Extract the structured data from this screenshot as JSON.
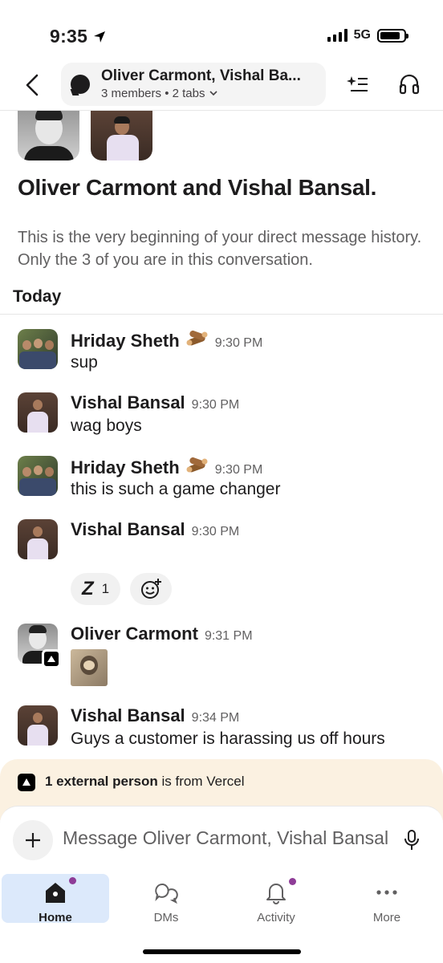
{
  "status_bar": {
    "time": "9:35",
    "network": "5G"
  },
  "header": {
    "title": "Oliver Carmont, Vishal Ba...",
    "subtitle": "3 members • 2 tabs"
  },
  "intro": {
    "title": "Oliver Carmont and Vishal Bansal.",
    "description": "This is the very beginning of your direct message history. Only the 3 of you are in this conversation."
  },
  "day_label": "Today",
  "messages": [
    {
      "name": "Hriday Sheth",
      "time": "9:30 PM",
      "text": "sup",
      "status_emoji": "wood-logs-icon"
    },
    {
      "name": "Vishal Bansal",
      "time": "9:30 PM",
      "text": "wag boys"
    },
    {
      "name": "Hriday Sheth",
      "time": "9:30 PM",
      "text": "this is such a game changer",
      "status_emoji": "wood-logs-icon"
    },
    {
      "name": "Vishal Bansal",
      "time": "9:30 PM",
      "text": ""
    },
    {
      "name": "Oliver Carmont",
      "time": "9:31 PM",
      "text": ""
    },
    {
      "name": "Vishal Bansal",
      "time": "9:34 PM",
      "text": "Guys a customer is harassing us off hours"
    }
  ],
  "reactions": [
    {
      "emoji": "Z",
      "count": "1"
    }
  ],
  "external_banner": {
    "bold": "1 external person",
    "rest": " is from Vercel"
  },
  "composer": {
    "placeholder": "Message Oliver Carmont, Vishal Bansal"
  },
  "tabs": [
    {
      "label": "Home",
      "icon": "home-icon"
    },
    {
      "label": "DMs",
      "icon": "dms-icon"
    },
    {
      "label": "Activity",
      "icon": "bell-icon"
    },
    {
      "label": "More",
      "icon": "more-icon"
    }
  ],
  "colors": {
    "accent_purple": "#8e3c97",
    "active_tab": "#dce9fb",
    "banner": "#fbf1e1"
  }
}
